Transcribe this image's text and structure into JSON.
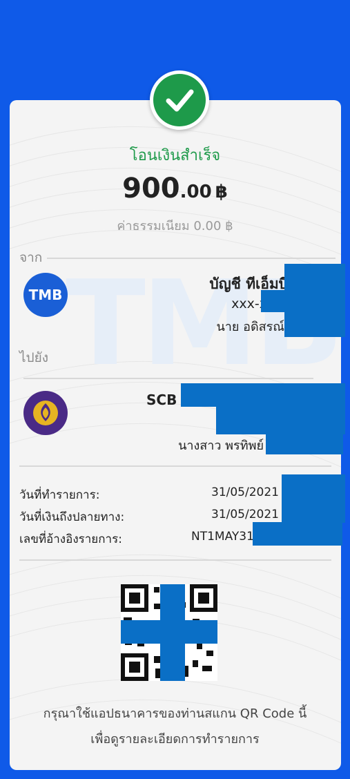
{
  "status": "โอนเงินสำเร็จ",
  "amount": {
    "whole": "900",
    "decimal": ".00",
    "currency": "฿"
  },
  "fee": "ค่าธรรมเนียม 0.00 ฿",
  "from": {
    "label": "จาก",
    "bank_logo": "TMB",
    "account_title": "บัญชี ทีเอ็มบี",
    "account_number": "xxx-x",
    "account_name": "นาย อดิสรณ์"
  },
  "to": {
    "label": "ไปยัง",
    "bank_name": "SCB",
    "account_name": "นางสาว พรทิพย์"
  },
  "details": [
    {
      "label": "วันที่ทำรายการ:",
      "value": "31/05/2021"
    },
    {
      "label": "วันที่เงินถึงปลายทาง:",
      "value": "31/05/2021"
    },
    {
      "label": "เลขที่อ้างอิงรายการ:",
      "value": "NT1MAY31"
    }
  ],
  "footer": {
    "line1": "กรุณาใช้แอปธนาคารของท่านสแกน QR Code นี้",
    "line2": "เพื่อดูรายละเอียดการทำรายการ"
  },
  "colors": {
    "background": "#0f5ae8",
    "success": "#1e9a4a",
    "mask": "#0a6fc6"
  }
}
